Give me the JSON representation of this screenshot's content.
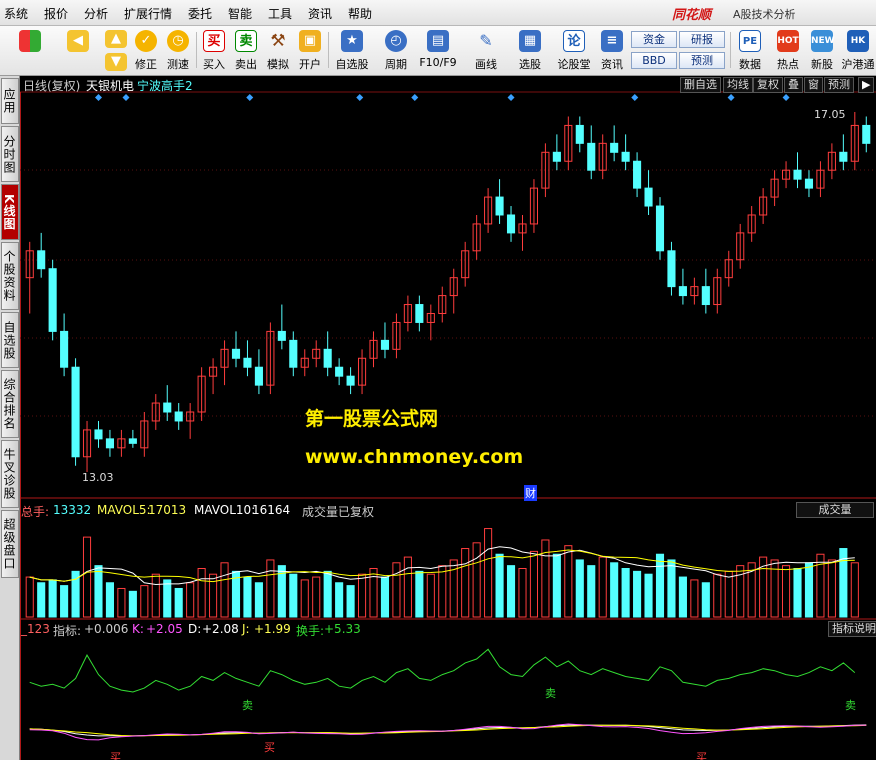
{
  "menu": [
    "系统",
    "报价",
    "分析",
    "扩展行情",
    "委托",
    "智能",
    "工具",
    "资讯",
    "帮助"
  ],
  "brand": "同花顺",
  "app_name": "A股技术分析",
  "toolbar": {
    "buttons": [
      {
        "label": "",
        "icon": "windows-icon"
      },
      {
        "label": "",
        "icon": "back-arrow-icon"
      },
      {
        "label": "",
        "icon": "up-arrow-icon"
      },
      {
        "label": "修正",
        "icon": "fix-icon"
      },
      {
        "label": "测速",
        "icon": "speed-test-icon"
      },
      {
        "label": "买入",
        "icon": "buy-icon",
        "glyph": "买"
      },
      {
        "label": "卖出",
        "icon": "sell-icon",
        "glyph": "卖"
      },
      {
        "label": "模拟",
        "icon": "hammer-icon"
      },
      {
        "label": "开户",
        "icon": "lock-icon"
      },
      {
        "label": "自选股",
        "icon": "star-icon"
      },
      {
        "label": "周期",
        "icon": "clock-icon"
      },
      {
        "label": "F10/F9",
        "icon": "f10-icon"
      },
      {
        "label": "画线",
        "icon": "pencil-icon"
      },
      {
        "label": "选股",
        "icon": "monitor-icon"
      },
      {
        "label": "论股堂",
        "icon": "discuss-icon",
        "glyph": "论"
      },
      {
        "label": "资讯",
        "icon": "news-icon"
      },
      {
        "label": "数据",
        "icon": "pe-icon",
        "glyph": "PE"
      },
      {
        "label": "热点",
        "icon": "hot-icon"
      },
      {
        "label": "新股",
        "icon": "new-stock-icon"
      },
      {
        "label": "沪港通",
        "icon": "hk-connect-icon"
      }
    ],
    "small_buttons": [
      "资金",
      "BBD",
      "研报",
      "预测"
    ]
  },
  "side_tabs": [
    "应用",
    "分时图",
    "K线图",
    "个股资料",
    "自选股",
    "综合排名",
    "牛叉诊股",
    "超级盘口"
  ],
  "active_side_tab": "K线图",
  "main_header": {
    "period": "日线(复权)",
    "stock": "天银机电",
    "formula": "宁波高手2",
    "buttons": [
      "删自选",
      "均线",
      "复权",
      "叠",
      "窗",
      "预测"
    ],
    "next_icon": "next-arrow-icon"
  },
  "price_labels": {
    "high": "17.05",
    "low": "13.03"
  },
  "finance_marker": "财",
  "volume_header": {
    "total_label": "总手:",
    "total": "13332",
    "ma5_label": "MAVOL5:",
    "ma5": "17013",
    "ma10_label": "MAVOL10:",
    "ma10": "16164",
    "note": "成交量已复权",
    "pane_button": "成交量"
  },
  "indicator_header": {
    "name": "_123",
    "index_label": "指标:",
    "index": "+0.006",
    "k_label": "K:",
    "k": "+2.05",
    "d_label": "D:",
    "d": "+2.08",
    "j_label": "J:",
    "j": "+1.99",
    "turnover_label": "换手:",
    "turnover": "+5.33",
    "pane_button": "指标说明"
  },
  "signals": {
    "buy": "买",
    "sell": "卖"
  },
  "watermark": {
    "title": "第一股票公式网",
    "url": "www.chnmoney.com"
  },
  "colors": {
    "up": "#ff3d3d",
    "down": "#54ffff",
    "ma5": "#ffffff",
    "ma10": "#ffff00",
    "index_line": "#33dd33",
    "k_line": "#ffffff",
    "d_line": "#ffff00",
    "j_line": "#ff55ff"
  },
  "chart_data": {
    "type": "candlestick",
    "price_range": [
      13.03,
      17.05
    ],
    "candles": [
      {
        "o": 15.2,
        "h": 15.6,
        "l": 14.8,
        "c": 15.5
      },
      {
        "o": 15.5,
        "h": 15.7,
        "l": 15.2,
        "c": 15.3
      },
      {
        "o": 15.3,
        "h": 15.4,
        "l": 14.5,
        "c": 14.6
      },
      {
        "o": 14.6,
        "h": 14.8,
        "l": 14.1,
        "c": 14.2
      },
      {
        "o": 14.2,
        "h": 14.3,
        "l": 13.1,
        "c": 13.2
      },
      {
        "o": 13.2,
        "h": 13.6,
        "l": 13.03,
        "c": 13.5
      },
      {
        "o": 13.5,
        "h": 13.6,
        "l": 13.3,
        "c": 13.4
      },
      {
        "o": 13.4,
        "h": 13.5,
        "l": 13.2,
        "c": 13.3
      },
      {
        "o": 13.3,
        "h": 13.5,
        "l": 13.2,
        "c": 13.4
      },
      {
        "o": 13.4,
        "h": 13.5,
        "l": 13.3,
        "c": 13.35
      },
      {
        "o": 13.3,
        "h": 13.7,
        "l": 13.2,
        "c": 13.6
      },
      {
        "o": 13.6,
        "h": 13.9,
        "l": 13.5,
        "c": 13.8
      },
      {
        "o": 13.8,
        "h": 14.0,
        "l": 13.6,
        "c": 13.7
      },
      {
        "o": 13.7,
        "h": 13.8,
        "l": 13.5,
        "c": 13.6
      },
      {
        "o": 13.6,
        "h": 13.8,
        "l": 13.4,
        "c": 13.7
      },
      {
        "o": 13.7,
        "h": 14.2,
        "l": 13.6,
        "c": 14.1
      },
      {
        "o": 14.1,
        "h": 14.3,
        "l": 13.9,
        "c": 14.2
      },
      {
        "o": 14.2,
        "h": 14.5,
        "l": 14.0,
        "c": 14.4
      },
      {
        "o": 14.4,
        "h": 14.6,
        "l": 14.2,
        "c": 14.3
      },
      {
        "o": 14.3,
        "h": 14.5,
        "l": 14.1,
        "c": 14.2
      },
      {
        "o": 14.2,
        "h": 14.4,
        "l": 13.9,
        "c": 14.0
      },
      {
        "o": 14.0,
        "h": 14.7,
        "l": 13.9,
        "c": 14.6
      },
      {
        "o": 14.6,
        "h": 14.9,
        "l": 14.4,
        "c": 14.5
      },
      {
        "o": 14.5,
        "h": 14.6,
        "l": 14.1,
        "c": 14.2
      },
      {
        "o": 14.2,
        "h": 14.4,
        "l": 14.1,
        "c": 14.3
      },
      {
        "o": 14.3,
        "h": 14.5,
        "l": 14.2,
        "c": 14.4
      },
      {
        "o": 14.4,
        "h": 14.6,
        "l": 14.1,
        "c": 14.2
      },
      {
        "o": 14.2,
        "h": 14.3,
        "l": 14.0,
        "c": 14.1
      },
      {
        "o": 14.1,
        "h": 14.2,
        "l": 13.9,
        "c": 14.0
      },
      {
        "o": 14.0,
        "h": 14.4,
        "l": 13.9,
        "c": 14.3
      },
      {
        "o": 14.3,
        "h": 14.6,
        "l": 14.2,
        "c": 14.5
      },
      {
        "o": 14.5,
        "h": 14.7,
        "l": 14.3,
        "c": 14.4
      },
      {
        "o": 14.4,
        "h": 14.8,
        "l": 14.3,
        "c": 14.7
      },
      {
        "o": 14.7,
        "h": 15.0,
        "l": 14.6,
        "c": 14.9
      },
      {
        "o": 14.9,
        "h": 15.0,
        "l": 14.6,
        "c": 14.7
      },
      {
        "o": 14.7,
        "h": 14.9,
        "l": 14.5,
        "c": 14.8
      },
      {
        "o": 14.8,
        "h": 15.1,
        "l": 14.7,
        "c": 15.0
      },
      {
        "o": 15.0,
        "h": 15.3,
        "l": 14.8,
        "c": 15.2
      },
      {
        "o": 15.2,
        "h": 15.6,
        "l": 15.1,
        "c": 15.5
      },
      {
        "o": 15.5,
        "h": 15.9,
        "l": 15.4,
        "c": 15.8
      },
      {
        "o": 15.8,
        "h": 16.2,
        "l": 15.7,
        "c": 16.1
      },
      {
        "o": 16.1,
        "h": 16.3,
        "l": 15.8,
        "c": 15.9
      },
      {
        "o": 15.9,
        "h": 16.0,
        "l": 15.6,
        "c": 15.7
      },
      {
        "o": 15.7,
        "h": 15.9,
        "l": 15.5,
        "c": 15.8
      },
      {
        "o": 15.8,
        "h": 16.3,
        "l": 15.7,
        "c": 16.2
      },
      {
        "o": 16.2,
        "h": 16.7,
        "l": 16.1,
        "c": 16.6
      },
      {
        "o": 16.6,
        "h": 16.8,
        "l": 16.4,
        "c": 16.5
      },
      {
        "o": 16.5,
        "h": 17.0,
        "l": 16.4,
        "c": 16.9
      },
      {
        "o": 16.9,
        "h": 17.0,
        "l": 16.6,
        "c": 16.7
      },
      {
        "o": 16.7,
        "h": 16.9,
        "l": 16.3,
        "c": 16.4
      },
      {
        "o": 16.4,
        "h": 16.8,
        "l": 16.3,
        "c": 16.7
      },
      {
        "o": 16.7,
        "h": 16.9,
        "l": 16.5,
        "c": 16.6
      },
      {
        "o": 16.6,
        "h": 16.8,
        "l": 16.4,
        "c": 16.5
      },
      {
        "o": 16.5,
        "h": 16.6,
        "l": 16.1,
        "c": 16.2
      },
      {
        "o": 16.2,
        "h": 16.4,
        "l": 15.9,
        "c": 16.0
      },
      {
        "o": 16.0,
        "h": 16.1,
        "l": 15.4,
        "c": 15.5
      },
      {
        "o": 15.5,
        "h": 15.6,
        "l": 15.0,
        "c": 15.1
      },
      {
        "o": 15.1,
        "h": 15.3,
        "l": 14.9,
        "c": 15.0
      },
      {
        "o": 15.0,
        "h": 15.2,
        "l": 14.9,
        "c": 15.1
      },
      {
        "o": 15.1,
        "h": 15.3,
        "l": 14.8,
        "c": 14.9
      },
      {
        "o": 14.9,
        "h": 15.3,
        "l": 14.8,
        "c": 15.2
      },
      {
        "o": 15.2,
        "h": 15.5,
        "l": 15.1,
        "c": 15.4
      },
      {
        "o": 15.4,
        "h": 15.8,
        "l": 15.3,
        "c": 15.7
      },
      {
        "o": 15.7,
        "h": 16.0,
        "l": 15.6,
        "c": 15.9
      },
      {
        "o": 15.9,
        "h": 16.2,
        "l": 15.8,
        "c": 16.1
      },
      {
        "o": 16.1,
        "h": 16.4,
        "l": 16.0,
        "c": 16.3
      },
      {
        "o": 16.3,
        "h": 16.5,
        "l": 16.2,
        "c": 16.4
      },
      {
        "o": 16.4,
        "h": 16.6,
        "l": 16.2,
        "c": 16.3
      },
      {
        "o": 16.3,
        "h": 16.4,
        "l": 16.1,
        "c": 16.2
      },
      {
        "o": 16.2,
        "h": 16.5,
        "l": 16.1,
        "c": 16.4
      },
      {
        "o": 16.4,
        "h": 16.7,
        "l": 16.3,
        "c": 16.6
      },
      {
        "o": 16.6,
        "h": 16.8,
        "l": 16.4,
        "c": 16.5
      },
      {
        "o": 16.5,
        "h": 17.05,
        "l": 16.4,
        "c": 16.9
      },
      {
        "o": 16.9,
        "h": 17.0,
        "l": 16.6,
        "c": 16.7
      }
    ],
    "volume": [
      14,
      12,
      13,
      11,
      16,
      28,
      18,
      12,
      10,
      9,
      11,
      15,
      13,
      10,
      12,
      17,
      15,
      19,
      16,
      14,
      12,
      20,
      18,
      15,
      13,
      14,
      16,
      12,
      11,
      15,
      17,
      14,
      19,
      21,
      16,
      15,
      18,
      20,
      24,
      26,
      31,
      22,
      18,
      17,
      23,
      27,
      22,
      25,
      20,
      18,
      21,
      19,
      17,
      16,
      15,
      22,
      20,
      14,
      13,
      12,
      15,
      16,
      18,
      19,
      21,
      20,
      18,
      17,
      19,
      22,
      20,
      24,
      19
    ],
    "volume_range": [
      0,
      34
    ]
  }
}
